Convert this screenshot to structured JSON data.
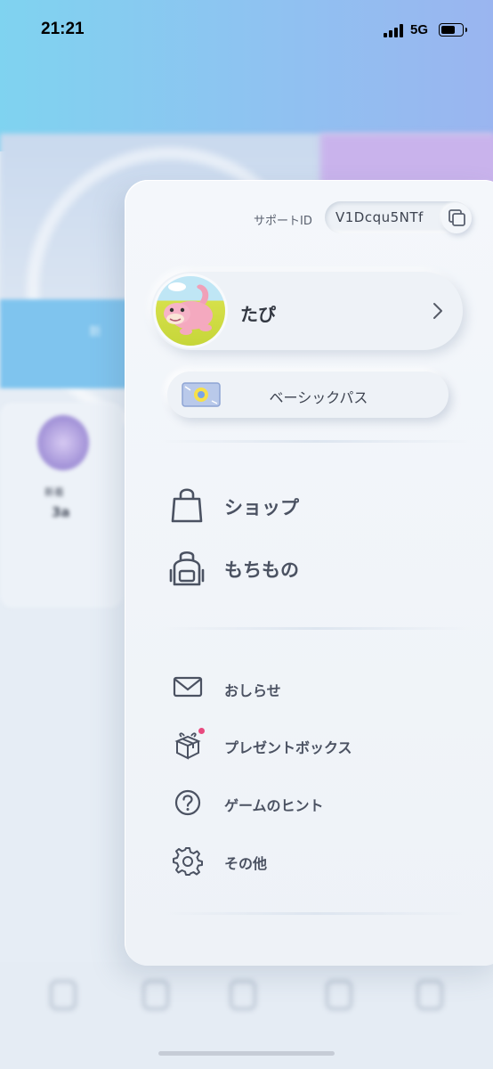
{
  "status_bar": {
    "time": "21:21",
    "network": "5G"
  },
  "background": {
    "band_text": "新",
    "card_label": "新着",
    "card_value": "3a"
  },
  "menu": {
    "support": {
      "label": "サポートID",
      "id_value": "V1Dcqu5NTf",
      "copy_icon": "copy-icon"
    },
    "profile": {
      "name": "たぴ",
      "avatar_icon": "slowpoke-avatar",
      "chevron_icon": "chevron-right-icon"
    },
    "pass": {
      "label": "ベーシックパス",
      "icon": "pass-ticket-icon"
    },
    "main_items": [
      {
        "label": "ショップ",
        "icon": "shopping-bag-icon"
      },
      {
        "label": "もちもの",
        "icon": "backpack-icon"
      }
    ],
    "sub_items": [
      {
        "label": "おしらせ",
        "icon": "mail-icon"
      },
      {
        "label": "プレゼントボックス",
        "icon": "gift-icon",
        "badge": true
      },
      {
        "label": "ゲームのヒント",
        "icon": "question-icon"
      },
      {
        "label": "その他",
        "icon": "gear-icon"
      }
    ]
  },
  "colors": {
    "accent_badge": "#e84a7f",
    "text_primary": "#4b5262",
    "panel_bg": "#f4f7fb"
  }
}
